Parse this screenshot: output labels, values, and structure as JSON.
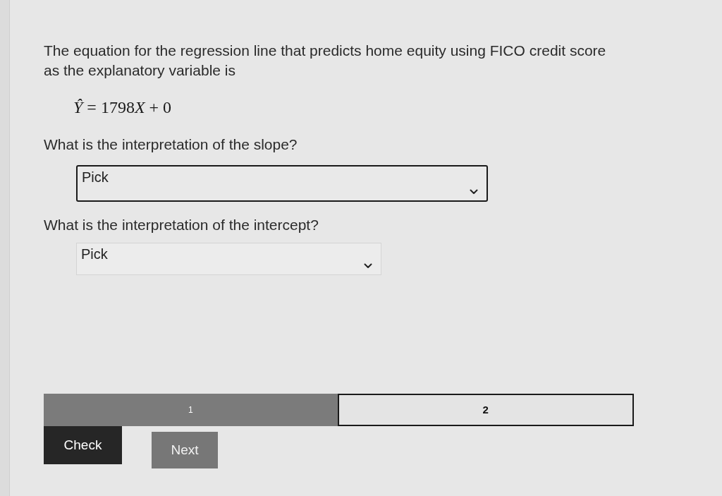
{
  "question": "The equation for the regression line that predicts home equity using FICO credit score as the explanatory variable is",
  "equation": [
    {
      "text": "Ŷ",
      "italic": true
    },
    {
      "text": "= 1798",
      "italic": false
    },
    {
      "text": "X",
      "italic": true
    },
    {
      "text": "+ 0",
      "italic": false
    }
  ],
  "items": [
    {
      "prompt": "What is the interpretation of the slope?",
      "dropdown": {
        "value": "Pick",
        "focused": true
      }
    },
    {
      "prompt": "What is the interpretation of the intercept?",
      "dropdown": {
        "value": "Pick",
        "focused": false
      }
    }
  ],
  "parts": [
    {
      "label": "1",
      "selected": true
    },
    {
      "label": "2",
      "selected": false
    }
  ],
  "buttons": [
    {
      "label": "Check",
      "kind": "primary"
    },
    {
      "label": "Next",
      "kind": "secondary"
    }
  ]
}
